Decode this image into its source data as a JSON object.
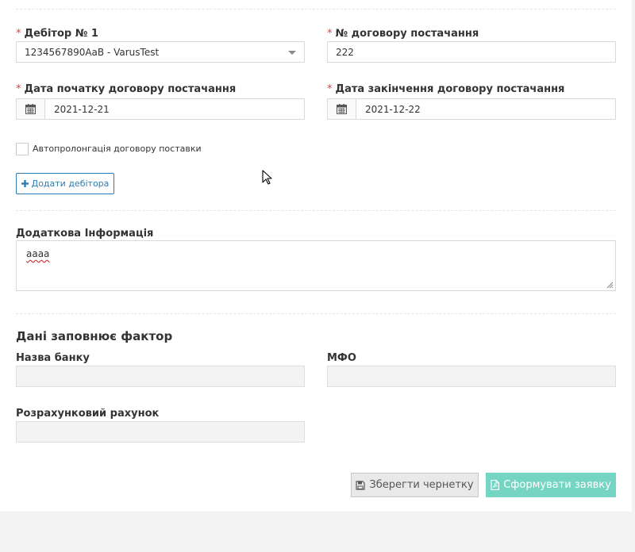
{
  "form": {
    "debtor_label": "Дебітор № 1",
    "debtor_value": "1234567890AaB - VarusTest",
    "contract_no_label": "№ договору постачання",
    "contract_no_value": "222",
    "start_date_label": "Дата початку договору постачання",
    "start_date_value": "2021-12-21",
    "end_date_label": "Дата закінчення договору постачання",
    "end_date_value": "2021-12-22",
    "required_mark": "*",
    "autoprolong_label": "Автопролонгація договору поставки",
    "autoprolong_checked": false,
    "add_debtor_label": "Додати дебітора",
    "additional_info_label": "Додаткова Інформація",
    "additional_info_value": "аааа"
  },
  "factor_section": {
    "title": "Дані заповнює фактор",
    "bank_name_label": "Назва банку",
    "bank_name_value": "",
    "mfo_label": "МФО",
    "mfo_value": "",
    "account_label": "Розрахунковий рахунок",
    "account_value": ""
  },
  "actions": {
    "save_draft_label": "Зберегти чернетку",
    "submit_label": "Сформувати заявку"
  },
  "icons": {
    "calendar": "calendar-icon",
    "plus": "plus-icon",
    "save": "floppy-disk-icon",
    "pdf": "pdf-file-icon",
    "cursor": "mouse-pointer-icon"
  },
  "colors": {
    "required": "#e0403f",
    "primary_outline": "#2a7db4",
    "submit_bg": "#74d6c2"
  }
}
